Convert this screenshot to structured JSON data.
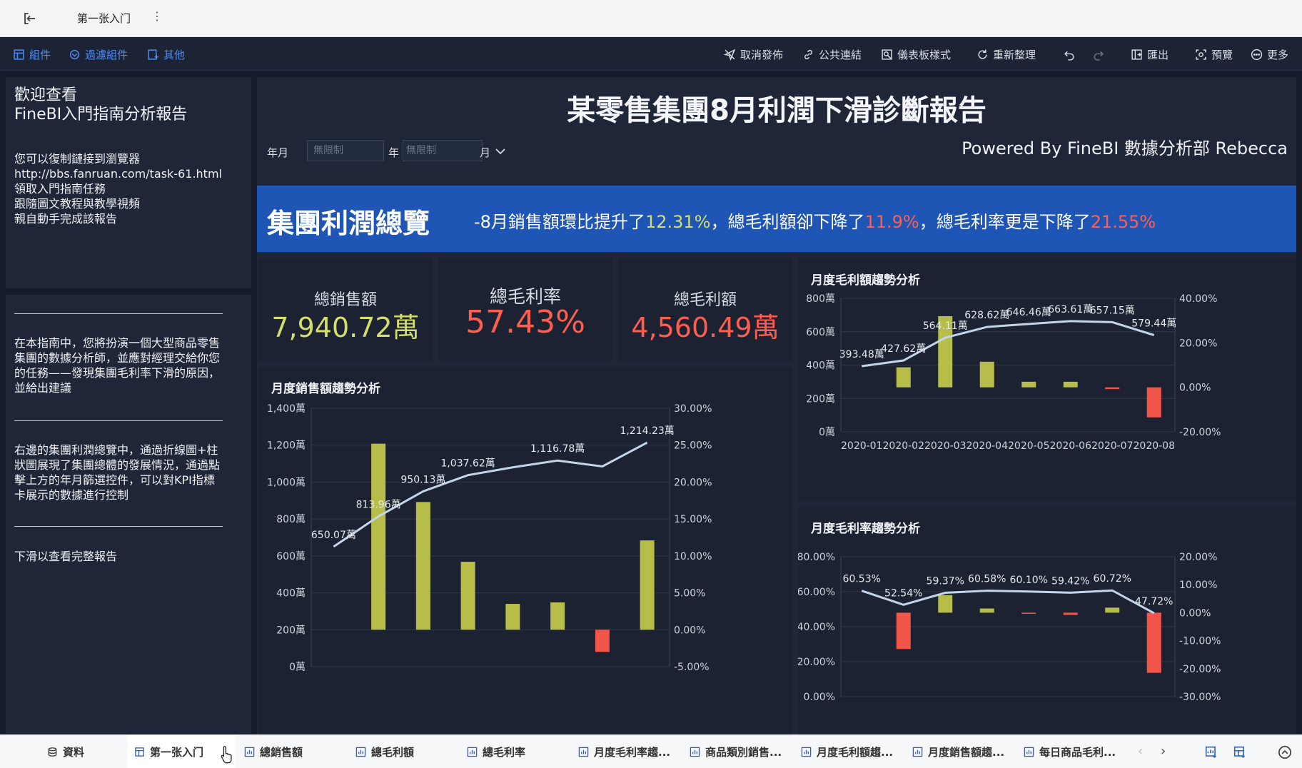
{
  "window": {
    "tab_title": "第一张入门"
  },
  "toolbar": {
    "left": [
      {
        "label": "組件",
        "icon": "component-icon"
      },
      {
        "label": "過濾組件",
        "icon": "filter-component-icon"
      },
      {
        "label": "其他",
        "icon": "other-icon"
      }
    ],
    "right": [
      {
        "label": "取消發佈",
        "icon": "unpublish-icon"
      },
      {
        "label": "公共連結",
        "icon": "link-icon"
      },
      {
        "label": "儀表板樣式",
        "icon": "dashboard-style-icon"
      },
      {
        "label": "重新整理",
        "icon": "refresh-icon"
      },
      {
        "label": "匯出",
        "icon": "export-icon"
      },
      {
        "label": "預覽",
        "icon": "preview-icon"
      },
      {
        "label": "更多",
        "icon": "more-icon"
      }
    ]
  },
  "left_panel": {
    "heading_line1": "歡迎查看",
    "heading_line2": "FineBI入門指南分析報告",
    "intro": [
      "您可以復制鏈接到瀏覽器",
      "http://bbs.fanruan.com/task-61.html",
      "領取入門指南任務",
      "跟隨圖文教程與教學視頻",
      "親自動手完成該報告"
    ],
    "para1": [
      "在本指南中，您將扮演一個大型商品零售",
      "集團的數據分析師，並應對經理交給你您",
      "的任務——發現集團毛利率下滑的原因，",
      "並給出建議"
    ],
    "para2": [
      "右邊的集團利潤總覽中，通過折線圖+柱",
      "狀圖展現了集團總體的發展情況，通過點",
      "擊上方的年月篩選控件，可以對KPI指標",
      "卡展示的數據進行控制"
    ],
    "para3": "下滑以查看完整報告"
  },
  "report": {
    "title": "某零售集團8月利潤下滑診斷報告",
    "powered_by": "Powered By FineBI 數據分析部 Rebecca",
    "filter": {
      "label": "年月",
      "year_placeholder": "無限制",
      "year_suffix": "年",
      "month_placeholder": "無限制",
      "month_suffix": "月"
    },
    "banner": {
      "title": "集團利潤總覽",
      "text_a": "-8月銷售額環比提升了",
      "v1": "12.31%",
      "text_b": "，總毛利額卻下降了",
      "v2": "11.9%",
      "text_c": "，總毛利率更是下降了",
      "v3": "21.55%"
    },
    "kpis": [
      {
        "label": "總銷售額",
        "value": "7,940.72萬",
        "color": "#d4de6a"
      },
      {
        "label": "總毛利率",
        "value": "57.43%",
        "color": "#ff5e4f"
      },
      {
        "label": "總毛利額",
        "value": "4,560.49萬",
        "color": "#ff5e4f"
      }
    ]
  },
  "chart_data": [
    {
      "type": "bar",
      "title": "月度銷售額趨勢分析",
      "note": "combo: bars = month-over-month growth rate (right axis), line = sales amount (left axis)",
      "categories": [
        "2020-01",
        "2020-02",
        "2020-03",
        "2020-04",
        "2020-05",
        "2020-06",
        "2020-07",
        "2020-08"
      ],
      "y_left_ticks": [
        "0萬",
        "200萬",
        "400萬",
        "600萬",
        "800萬",
        "1,000萬",
        "1,200萬",
        "1,400萬"
      ],
      "y_left_range": [
        0,
        1400
      ],
      "y_right_ticks": [
        "-5.00%",
        "0.00%",
        "5.00%",
        "10.00%",
        "15.00%",
        "20.00%",
        "25.00%",
        "30.00%"
      ],
      "y_right_range": [
        -5,
        30
      ],
      "series": [
        {
          "kind": "bar",
          "axis": "right",
          "values": [
            25.2,
            17.3,
            9.2,
            3.5,
            3.7,
            -3.0,
            12.1
          ]
        },
        {
          "kind": "line",
          "axis": "left",
          "values": [
            650.07,
            813.96,
            950.13,
            1037.62,
            1080,
            1116.78,
            1085,
            1214.23
          ],
          "labels": [
            "650.07萬",
            "813.96萬",
            "950.13萬",
            "1,037.62萬",
            "",
            "1,116.78萬",
            "",
            "1,214.23萬"
          ]
        }
      ]
    },
    {
      "type": "bar",
      "title": "月度毛利額趨勢分析",
      "note": "combo: bars = growth rate (right axis), line = gross profit (left axis)",
      "categories": [
        "2020-01",
        "2020-02",
        "2020-03",
        "2020-04",
        "2020-05",
        "2020-06",
        "2020-07",
        "2020-08"
      ],
      "x_labels": [
        "2020-01",
        "2020-02",
        "2020-03",
        "2020-04",
        "2020-05",
        "2020-06",
        "2020-07",
        "2020-08"
      ],
      "y_left_ticks": [
        "0萬",
        "200萬",
        "400萬",
        "600萬",
        "800萬"
      ],
      "y_left_range": [
        0,
        800
      ],
      "y_right_ticks": [
        "-20.00%",
        "0.00%",
        "20.00%",
        "40.00%"
      ],
      "y_right_range": [
        -20,
        40
      ],
      "series": [
        {
          "kind": "bar",
          "axis": "right",
          "values": [
            0,
            9.0,
            32.0,
            11.5,
            2.5,
            2.5,
            -0.8,
            -13.5
          ]
        },
        {
          "kind": "line",
          "axis": "left",
          "values": [
            393.48,
            427.62,
            564.11,
            628.62,
            646.46,
            663.61,
            657.15,
            579.44
          ],
          "labels": [
            "393.48萬",
            "427.62萬",
            "564.11萬",
            "628.62萬",
            "646.46萬",
            "663.61萬",
            "657.15萬",
            "579.44萬"
          ]
        }
      ]
    },
    {
      "type": "bar",
      "title": "月度毛利率趨勢分析",
      "note": "combo: bars = change (right axis), line = gross margin rate (left axis)",
      "categories": [
        "2020-01",
        "2020-02",
        "2020-03",
        "2020-04",
        "2020-05",
        "2020-06",
        "2020-07",
        "2020-08"
      ],
      "y_left_ticks": [
        "0.00%",
        "20.00%",
        "40.00%",
        "60.00%",
        "80.00%"
      ],
      "y_left_range": [
        0,
        80
      ],
      "y_right_ticks": [
        "-30.00%",
        "-20.00%",
        "-10.00%",
        "0.00%",
        "10.00%",
        "20.00%"
      ],
      "y_right_range": [
        -30,
        20
      ],
      "series": [
        {
          "kind": "bar",
          "axis": "right",
          "values": [
            0,
            -13.0,
            6.3,
            1.5,
            -0.4,
            -0.8,
            1.8,
            -21.5
          ]
        },
        {
          "kind": "line",
          "axis": "left",
          "values": [
            60.53,
            52.54,
            59.37,
            60.58,
            60.1,
            59.42,
            60.72,
            47.72
          ],
          "labels": [
            "60.53%",
            "52.54%",
            "59.37%",
            "60.58%",
            "60.10%",
            "59.42%",
            "60.72%",
            "47.72%"
          ]
        }
      ]
    }
  ],
  "bottom_tabs": [
    {
      "label": "資料",
      "icon": "database-icon"
    },
    {
      "label": "第一张入门",
      "icon": "dashboard-icon",
      "active": true
    },
    {
      "label": "總銷售額",
      "icon": "chart-icon"
    },
    {
      "label": "總毛利額",
      "icon": "chart-icon"
    },
    {
      "label": "總毛利率",
      "icon": "chart-icon"
    },
    {
      "label": "月度毛利率趨...",
      "icon": "chart-icon"
    },
    {
      "label": "商品類別銷售...",
      "icon": "chart-icon"
    },
    {
      "label": "月度毛利額趨...",
      "icon": "chart-icon"
    },
    {
      "label": "月度銷售額趨...",
      "icon": "chart-icon"
    },
    {
      "label": "每日商品毛利...",
      "icon": "chart-icon"
    }
  ],
  "colors": {
    "bar_positive": "#b6bd48",
    "bar_negative": "#f2564a",
    "line": "#c3d5ea",
    "accent_blue": "#4f8cf2"
  }
}
